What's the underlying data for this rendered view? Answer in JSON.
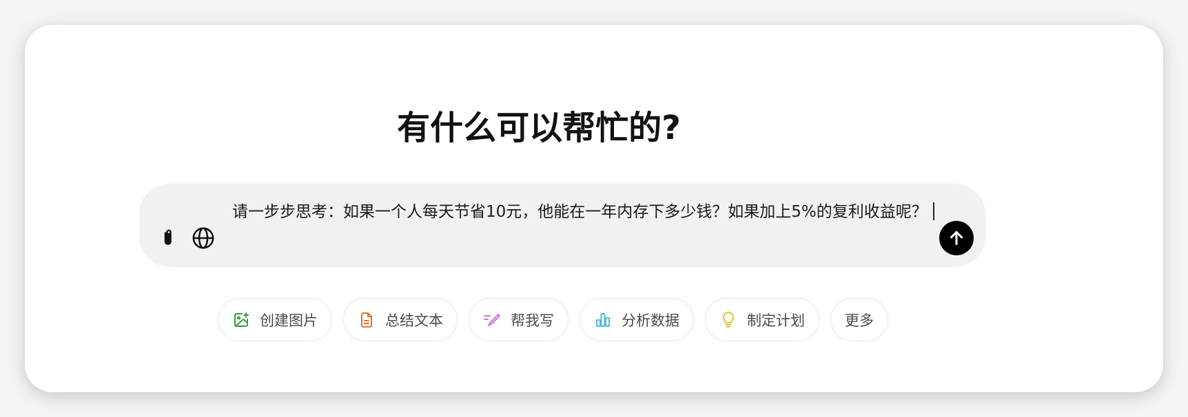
{
  "header": {
    "title": "有什么可以帮忙的?"
  },
  "composer": {
    "value": "请一步步思考：如果一个人每天节省10元，他能在一年内存下多少钱？如果加上5%的复利收益呢？",
    "attach_icon": "paperclip-icon",
    "web_icon": "globe-icon",
    "send_icon": "arrow-up-icon"
  },
  "suggestions": [
    {
      "label": "创建图片",
      "icon": "image-plus-icon",
      "color": "#2e9e3e"
    },
    {
      "label": "总结文本",
      "icon": "document-icon",
      "color": "#e8742c"
    },
    {
      "label": "帮我写",
      "icon": "pen-icon",
      "color": "#c779d0"
    },
    {
      "label": "分析数据",
      "icon": "bar-chart-icon",
      "color": "#53b7e0"
    },
    {
      "label": "制定计划",
      "icon": "lightbulb-icon",
      "color": "#e6be2e"
    },
    {
      "label": "更多"
    }
  ],
  "colors": {
    "composer_bg": "#f1f1f1",
    "send_bg": "#000000",
    "card_bg": "#ffffff"
  }
}
